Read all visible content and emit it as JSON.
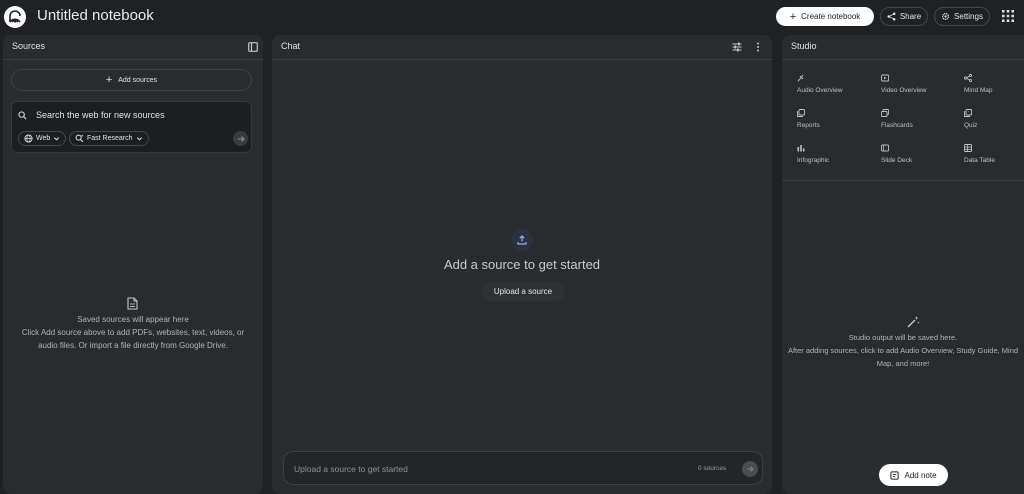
{
  "app": {
    "title": "Untitled notebook"
  },
  "header": {
    "create_label": "Create notebook",
    "share_label": "Share",
    "settings_label": "Settings"
  },
  "sources": {
    "title": "Sources",
    "add_label": "Add sources",
    "search_text": "Search the web for new sources",
    "web_chip": "Web",
    "research_chip": "Fast Research",
    "empty_title": "Saved sources will appear here",
    "empty_line1": "Click Add source above to add PDFs, websites, text, videos, or",
    "empty_line2": "audio files. Or import a file directly from Google Drive."
  },
  "chat": {
    "title": "Chat",
    "headline": "Add a source to get started",
    "upload_label": "Upload a source",
    "input_placeholder": "Upload a source to get started",
    "source_count": "0 sources"
  },
  "studio": {
    "title": "Studio",
    "tiles": [
      {
        "label": "Audio Overview",
        "icon": "audio-overview-icon"
      },
      {
        "label": "Video Overview",
        "icon": "video-overview-icon"
      },
      {
        "label": "Mind Map",
        "icon": "mind-map-icon"
      },
      {
        "label": "Reports",
        "icon": "reports-icon"
      },
      {
        "label": "Flashcards",
        "icon": "flashcards-icon"
      },
      {
        "label": "Quiz",
        "icon": "quiz-icon"
      },
      {
        "label": "Infographic",
        "icon": "infographic-icon"
      },
      {
        "label": "Slide Deck",
        "icon": "slide-deck-icon"
      },
      {
        "label": "Data Table",
        "icon": "data-table-icon"
      }
    ],
    "empty_title": "Studio output will be saved here.",
    "empty_line1": "After adding sources, click to add Audio Overview, Study Guide, Mind",
    "empty_line2": "Map, and more!",
    "add_note_label": "Add note"
  },
  "colors": {
    "background": "#202124",
    "panel": "#2a2b2e",
    "accent_blue": "#8ab4f8",
    "button_white": "#ffffff"
  }
}
